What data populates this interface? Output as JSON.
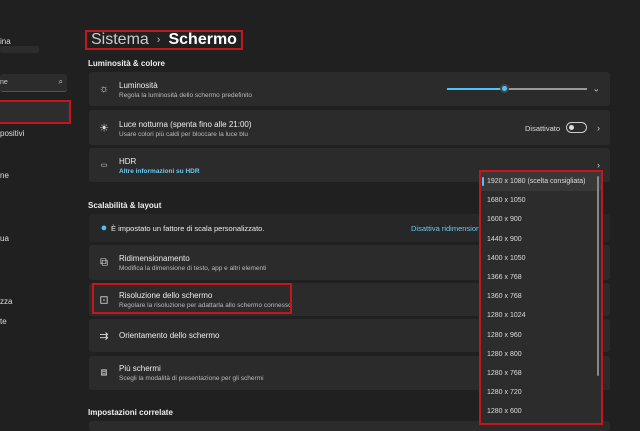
{
  "sidebar": {
    "account_name": "ina",
    "search_placeholder": "ne",
    "items": [
      "",
      "positivi",
      "ne",
      "ua",
      "zza",
      "te"
    ]
  },
  "breadcrumb": {
    "parent": "Sistema",
    "separator": "›",
    "current": "Schermo"
  },
  "sections": {
    "brightness_color": "Luminosità & colore",
    "scale_layout": "Scalabilità & layout",
    "related": "Impostazioni correlate"
  },
  "cards": {
    "brightness": {
      "title": "Luminosità",
      "subtitle": "Regola la luminosità dello schermo predefinito",
      "value_percent": 40
    },
    "night_light": {
      "title": "Luce notturna (spenta fino alle 21:00)",
      "subtitle": "Usare colori più caldi per bloccare la luce blu",
      "state": "Disattivato"
    },
    "hdr": {
      "title": "HDR",
      "link": "Altre informazioni su HDR"
    },
    "info": {
      "text": "È impostato un fattore di scala personalizzato.",
      "link": "Disattiva ridimensionamento"
    },
    "scaling": {
      "title": "Ridimensionamento",
      "subtitle": "Modifica la dimensione di testo, app e altri elementi"
    },
    "resolution": {
      "title": "Risoluzione dello schermo",
      "subtitle": "Regolare la risoluzione per adattarla allo schermo connesso"
    },
    "orientation": {
      "title": "Orientamento dello schermo"
    },
    "multi": {
      "title": "Più schermi",
      "subtitle": "Scegli la modalità di presentazione per gli schermi"
    }
  },
  "resolution_options": [
    "1920 x 1080 (scelta consigliata)",
    "1680 x 1050",
    "1600 x 900",
    "1440 x 900",
    "1400 x 1050",
    "1366 x 768",
    "1360 x 768",
    "1280 x 1024",
    "1280 x 960",
    "1280 x 800",
    "1280 x 768",
    "1280 x 720",
    "1280 x 600"
  ],
  "accent": "#4cc2ff"
}
